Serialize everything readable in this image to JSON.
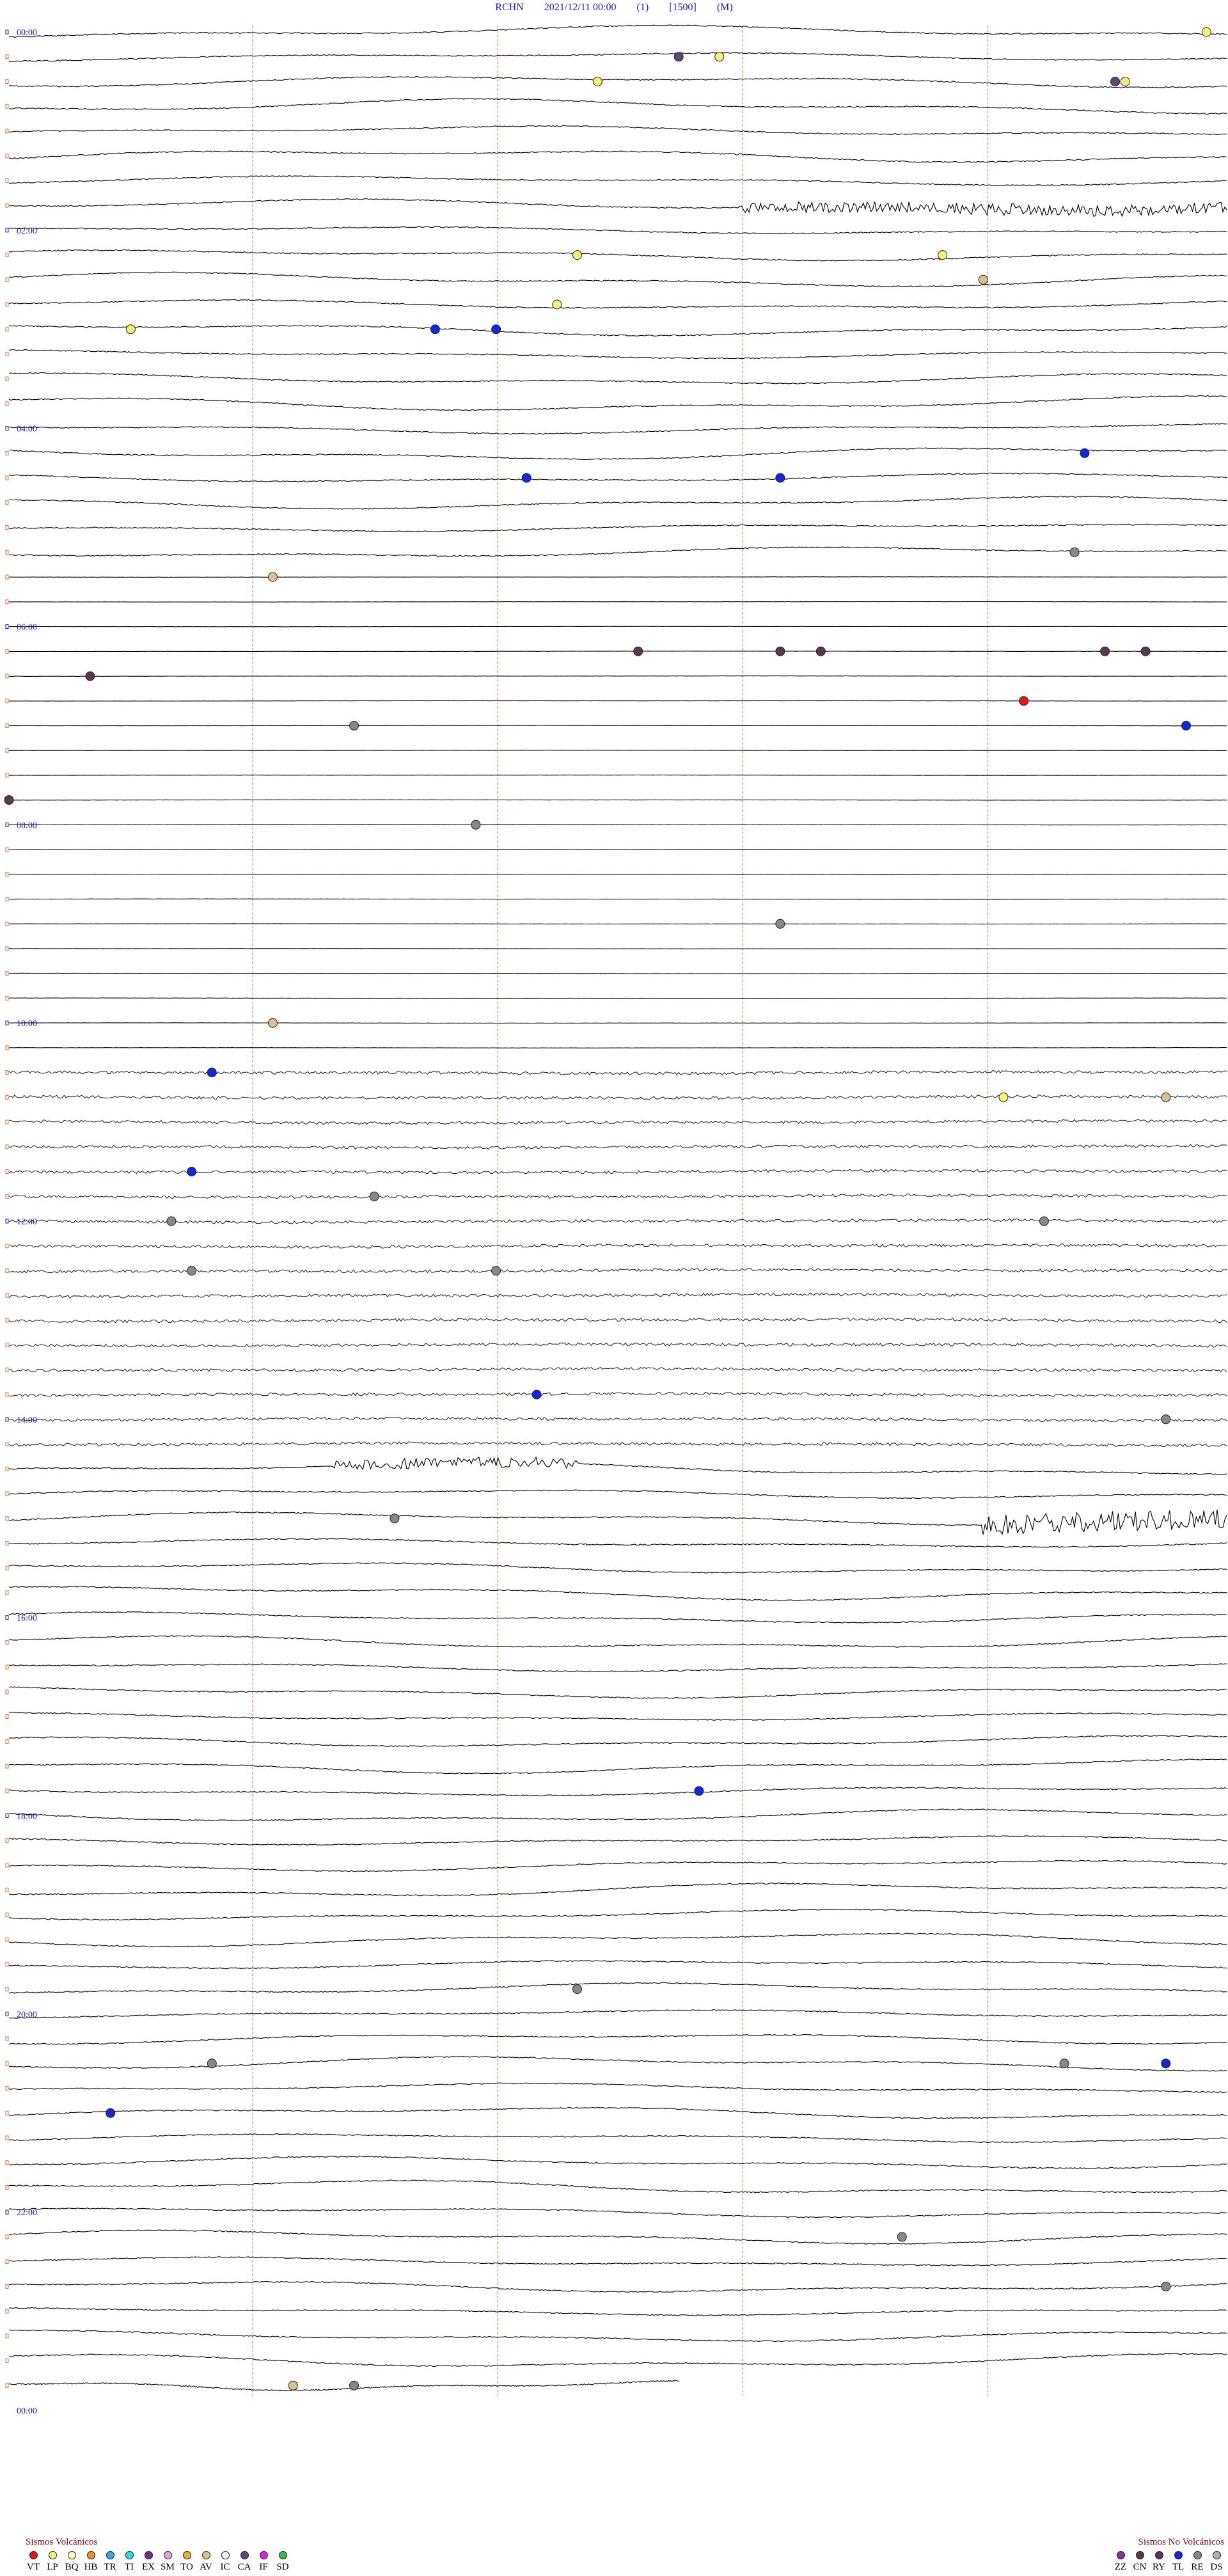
{
  "header": {
    "station": "RCHN",
    "datetime": "2021/12/11 00:00",
    "channel": "(1)",
    "scale": "[1500]",
    "component": "(M)"
  },
  "colors": {
    "trace": "#000000",
    "hour_label": "#1a1aa8",
    "minute_marker": "#e06a2a",
    "minute_gridline": "#f2a57a"
  },
  "chart_data": {
    "type": "helicorder",
    "traces_per_hour": 4,
    "hours_on_record": 24,
    "hour_labels": [
      "00:00",
      "02:00",
      "04:00",
      "06:00",
      "08:00",
      "10:00",
      "12:00",
      "14:00",
      "16:00",
      "18:00",
      "20:00",
      "22:00",
      "00:00"
    ],
    "hour_label_every_traces": 8,
    "minute_gridlines_count": 4,
    "bands": [
      {
        "hour_start": 0,
        "hour_end": 5.5,
        "style": "wavy"
      },
      {
        "hour_start": 5.5,
        "hour_end": 10.5,
        "style": "flat"
      },
      {
        "hour_start": 10.5,
        "hour_end": 14.5,
        "style": "dense"
      },
      {
        "hour_start": 14.5,
        "hour_end": 24,
        "style": "wavy"
      }
    ],
    "bursts": [
      {
        "hour": 1.75,
        "minute": 24,
        "duration_min": 12,
        "amplitude": 9
      },
      {
        "hour": 15.0,
        "minute": 27,
        "duration_min": 6,
        "amplitude": 16
      },
      {
        "hour": 14.5,
        "minute": 34,
        "duration_min": 3,
        "amplitude": 8
      }
    ],
    "events": [
      {
        "type": "LP",
        "hour": 0.0,
        "minute": 59
      },
      {
        "type": "CA",
        "hour": 0.25,
        "minute": 33
      },
      {
        "type": "LP",
        "hour": 0.25,
        "minute": 35
      },
      {
        "type": "LP",
        "hour": 0.5,
        "minute": 29
      },
      {
        "type": "LP",
        "hour": 0.5,
        "minute": 55
      },
      {
        "type": "CA",
        "hour": 0.5,
        "minute": 54.5
      },
      {
        "type": "LP",
        "hour": 2.25,
        "minute": 28
      },
      {
        "type": "LP",
        "hour": 2.25,
        "minute": 46
      },
      {
        "type": "AV",
        "hour": 2.5,
        "minute": 48
      },
      {
        "type": "LP",
        "hour": 2.75,
        "minute": 27
      },
      {
        "type": "LP",
        "hour": 3.0,
        "minute": 6
      },
      {
        "type": "TL",
        "hour": 3.0,
        "minute": 21
      },
      {
        "type": "TL",
        "hour": 3.0,
        "minute": 24
      },
      {
        "type": "TL",
        "hour": 4.25,
        "minute": 53
      },
      {
        "type": "TL",
        "hour": 4.5,
        "minute": 38
      },
      {
        "type": "TL",
        "hour": 4.5,
        "minute": 25.5
      },
      {
        "type": "RE",
        "hour": 5.25,
        "minute": 52.5
      },
      {
        "type": "AV",
        "hour": 5.5,
        "minute": 13
      },
      {
        "type": "CN",
        "hour": 6.25,
        "minute": 31
      },
      {
        "type": "CN",
        "hour": 6.25,
        "minute": 38
      },
      {
        "type": "CN",
        "hour": 6.25,
        "minute": 40
      },
      {
        "type": "CN",
        "hour": 6.25,
        "minute": 54
      },
      {
        "type": "CN",
        "hour": 6.25,
        "minute": 56
      },
      {
        "type": "CN",
        "hour": 6.5,
        "minute": 4
      },
      {
        "type": "VT",
        "hour": 6.75,
        "minute": 50
      },
      {
        "type": "TL",
        "hour": 7.0,
        "minute": 58
      },
      {
        "type": "RE",
        "hour": 7.0,
        "minute": 17
      },
      {
        "type": "CN",
        "hour": 7.75,
        "minute": 0
      },
      {
        "type": "RE",
        "hour": 8.0,
        "minute": 23
      },
      {
        "type": "RE",
        "hour": 9.0,
        "minute": 38
      },
      {
        "type": "AV",
        "hour": 10.0,
        "minute": 13
      },
      {
        "type": "TL",
        "hour": 10.5,
        "minute": 10
      },
      {
        "type": "LP",
        "hour": 10.75,
        "minute": 49
      },
      {
        "type": "AV",
        "hour": 10.75,
        "minute": 57
      },
      {
        "type": "TL",
        "hour": 11.5,
        "minute": 9
      },
      {
        "type": "RE",
        "hour": 11.75,
        "minute": 18
      },
      {
        "type": "RE",
        "hour": 12.0,
        "minute": 8
      },
      {
        "type": "RE",
        "hour": 12.0,
        "minute": 51
      },
      {
        "type": "RE",
        "hour": 12.5,
        "minute": 9
      },
      {
        "type": "RE",
        "hour": 12.5,
        "minute": 24
      },
      {
        "type": "TL",
        "hour": 13.75,
        "minute": 26
      },
      {
        "type": "RE",
        "hour": 14.0,
        "minute": 57
      },
      {
        "type": "RE",
        "hour": 15.0,
        "minute": 19
      },
      {
        "type": "TL",
        "hour": 17.75,
        "minute": 34
      },
      {
        "type": "RE",
        "hour": 19.75,
        "minute": 28
      },
      {
        "type": "RE",
        "hour": 20.5,
        "minute": 10
      },
      {
        "type": "TL",
        "hour": 20.5,
        "minute": 57
      },
      {
        "type": "RE",
        "hour": 20.5,
        "minute": 52
      },
      {
        "type": "TL",
        "hour": 21.0,
        "minute": 5
      },
      {
        "type": "RE",
        "hour": 22.25,
        "minute": 44
      },
      {
        "type": "RE",
        "hour": 22.75,
        "minute": 57
      },
      {
        "type": "AV",
        "hour": 23.75,
        "minute": 14
      },
      {
        "type": "RE",
        "hour": 23.75,
        "minute": 17
      }
    ]
  },
  "legend_volcanic": {
    "title": "Sismos Volcánicos",
    "items": [
      {
        "code": "VT",
        "color": "#e8141a"
      },
      {
        "code": "LP",
        "color": "#f4f07a"
      },
      {
        "code": "BQ",
        "color": "#fff9c0"
      },
      {
        "code": "HB",
        "color": "#f08c28"
      },
      {
        "code": "TR",
        "color": "#3aa6e8"
      },
      {
        "code": "TI",
        "color": "#34d8d4"
      },
      {
        "code": "EX",
        "color": "#7a2a8a"
      },
      {
        "code": "SM",
        "color": "#e8a0d8"
      },
      {
        "code": "TO",
        "color": "#e8b030"
      },
      {
        "code": "AV",
        "color": "#d8c090"
      },
      {
        "code": "IC",
        "color": "#f0f0f0"
      },
      {
        "code": "CA",
        "color": "#604878"
      },
      {
        "code": "IF",
        "color": "#e020d8"
      },
      {
        "code": "SD",
        "color": "#3cb84a"
      }
    ]
  },
  "legend_nonvolcanic": {
    "title": "Sismos No Volcánicos",
    "items": [
      {
        "code": "ZZ",
        "color": "#8030a0"
      },
      {
        "code": "CN",
        "color": "#5a3850"
      },
      {
        "code": "RY",
        "color": "#603060"
      },
      {
        "code": "TL",
        "color": "#1428d8"
      },
      {
        "code": "RE",
        "color": "#888888"
      },
      {
        "code": "DS",
        "color": "#b0b0b0"
      }
    ]
  }
}
